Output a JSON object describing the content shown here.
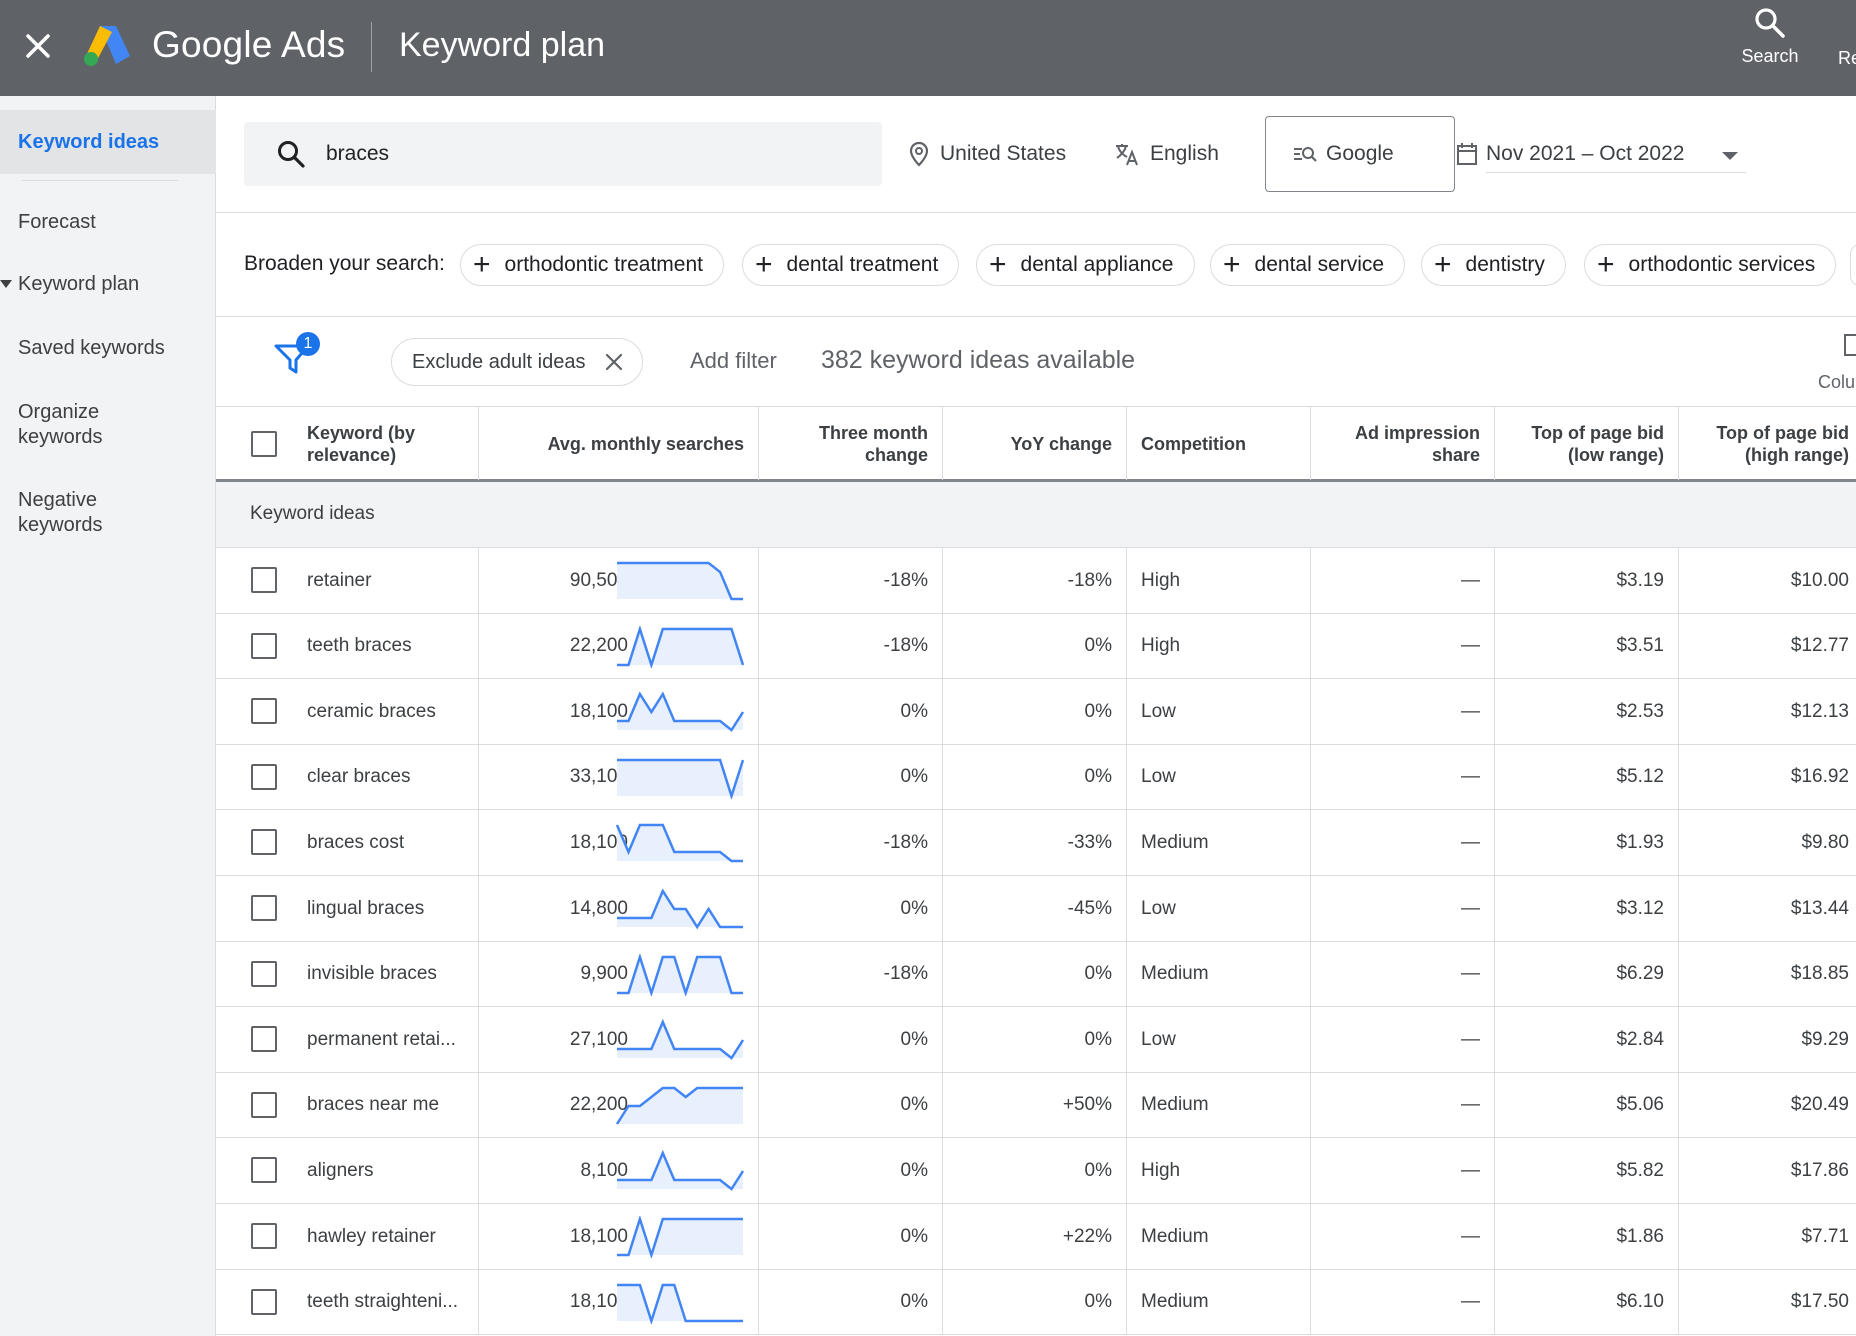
{
  "topbar": {
    "brand_main": "Google",
    "brand_product": "Ads",
    "page_title": "Keyword plan",
    "search_label": "Search",
    "cut_label": "Re"
  },
  "sidebar": {
    "items": [
      {
        "label": "Keyword ideas",
        "active": true
      },
      {
        "label": "Forecast"
      },
      {
        "label": "Keyword plan",
        "expandable": true
      },
      {
        "label": "Saved keywords"
      },
      {
        "label": "Organize keywords"
      },
      {
        "label": "Negative keywords"
      }
    ]
  },
  "search": {
    "query": "braces",
    "location": "United States",
    "language": "English",
    "network": "Google",
    "date_range": "Nov 2021 – Oct 2022"
  },
  "broaden": {
    "label": "Broaden your search:",
    "chips": [
      "orthodontic treatment",
      "dental treatment",
      "dental appliance",
      "dental service",
      "dentistry",
      "orthodontic services"
    ]
  },
  "filters": {
    "badge_count": "1",
    "active_filter": "Exclude adult ideas",
    "add_filter_label": "Add filter",
    "ideas_count": "382 keyword ideas available",
    "columns_label": "Colu"
  },
  "table": {
    "headers": {
      "keyword": "Keyword (by relevance)",
      "avg": "Avg. monthly searches",
      "three_month": "Three month change",
      "yoy": "YoY change",
      "competition": "Competition",
      "impression": "Ad impression share",
      "bid_low": "Top of page bid (low range)",
      "bid_high": "Top of page bid (high range)"
    },
    "group_label": "Keyword ideas",
    "rows": [
      {
        "keyword": "retainer",
        "avg": "90,500",
        "three_month": "-18%",
        "yoy": "-18%",
        "competition": "High",
        "impression": "—",
        "bid_low": "$3.19",
        "bid_high": "$10.00",
        "trend": [
          4,
          4,
          4,
          4,
          4,
          4,
          4,
          4,
          4,
          3,
          0,
          0
        ]
      },
      {
        "keyword": "teeth braces",
        "avg": "22,200",
        "three_month": "-18%",
        "yoy": "0%",
        "competition": "High",
        "impression": "—",
        "bid_low": "$3.51",
        "bid_high": "$12.77",
        "trend": [
          0,
          0,
          4,
          0,
          4,
          4,
          4,
          4,
          4,
          4,
          4,
          0
        ]
      },
      {
        "keyword": "ceramic braces",
        "avg": "18,100",
        "three_month": "0%",
        "yoy": "0%",
        "competition": "Low",
        "impression": "—",
        "bid_low": "$2.53",
        "bid_high": "$12.13",
        "trend": [
          1,
          1,
          4,
          2,
          4,
          1,
          1,
          1,
          1,
          1,
          0,
          2
        ]
      },
      {
        "keyword": "clear braces",
        "avg": "33,100",
        "three_month": "0%",
        "yoy": "0%",
        "competition": "Low",
        "impression": "—",
        "bid_low": "$5.12",
        "bid_high": "$16.92",
        "trend": [
          4,
          4,
          4,
          4,
          4,
          4,
          4,
          4,
          4,
          4,
          0,
          4
        ]
      },
      {
        "keyword": "braces cost",
        "avg": "18,100",
        "three_month": "-18%",
        "yoy": "-33%",
        "competition": "Medium",
        "impression": "—",
        "bid_low": "$1.93",
        "bid_high": "$9.80",
        "trend": [
          4,
          1,
          4,
          4,
          4,
          1,
          1,
          1,
          1,
          1,
          0,
          0
        ]
      },
      {
        "keyword": "lingual braces",
        "avg": "14,800",
        "three_month": "0%",
        "yoy": "-45%",
        "competition": "Low",
        "impression": "—",
        "bid_low": "$3.12",
        "bid_high": "$13.44",
        "trend": [
          1,
          1,
          1,
          1,
          4,
          2,
          2,
          0,
          2,
          0,
          0,
          0
        ]
      },
      {
        "keyword": "invisible braces",
        "avg": "9,900",
        "three_month": "-18%",
        "yoy": "0%",
        "competition": "Medium",
        "impression": "—",
        "bid_low": "$6.29",
        "bid_high": "$18.85",
        "trend": [
          0,
          0,
          4,
          0,
          4,
          4,
          0,
          4,
          4,
          4,
          0,
          0
        ]
      },
      {
        "keyword": "permanent retai...",
        "avg": "27,100",
        "three_month": "0%",
        "yoy": "0%",
        "competition": "Low",
        "impression": "—",
        "bid_low": "$2.84",
        "bid_high": "$9.29",
        "trend": [
          1,
          1,
          1,
          1,
          4,
          1,
          1,
          1,
          1,
          1,
          0,
          2
        ]
      },
      {
        "keyword": "braces near me",
        "avg": "22,200",
        "three_month": "0%",
        "yoy": "+50%",
        "competition": "Medium",
        "impression": "—",
        "bid_low": "$5.06",
        "bid_high": "$20.49",
        "trend": [
          0,
          2,
          2,
          3,
          4,
          4,
          3,
          4,
          4,
          4,
          4,
          4
        ]
      },
      {
        "keyword": "aligners",
        "avg": "8,100",
        "three_month": "0%",
        "yoy": "0%",
        "competition": "High",
        "impression": "—",
        "bid_low": "$5.82",
        "bid_high": "$17.86",
        "trend": [
          1,
          1,
          1,
          1,
          4,
          1,
          1,
          1,
          1,
          1,
          0,
          2
        ]
      },
      {
        "keyword": "hawley retainer",
        "avg": "18,100",
        "three_month": "0%",
        "yoy": "+22%",
        "competition": "Medium",
        "impression": "—",
        "bid_low": "$1.86",
        "bid_high": "$7.71",
        "trend": [
          0,
          0,
          4,
          0,
          4,
          4,
          4,
          4,
          4,
          4,
          4,
          4
        ]
      },
      {
        "keyword": "teeth straighteni...",
        "avg": "18,100",
        "three_month": "0%",
        "yoy": "0%",
        "competition": "Medium",
        "impression": "—",
        "bid_low": "$6.10",
        "bid_high": "$17.50",
        "trend": [
          4,
          4,
          4,
          0,
          4,
          4,
          0,
          0,
          0,
          0,
          0,
          0
        ]
      }
    ]
  },
  "colors": {
    "topbar": "#5f6368",
    "accent": "#1a73e8",
    "sparkline": "#4285f4",
    "sparkline_fill": "#e8f0fe"
  }
}
